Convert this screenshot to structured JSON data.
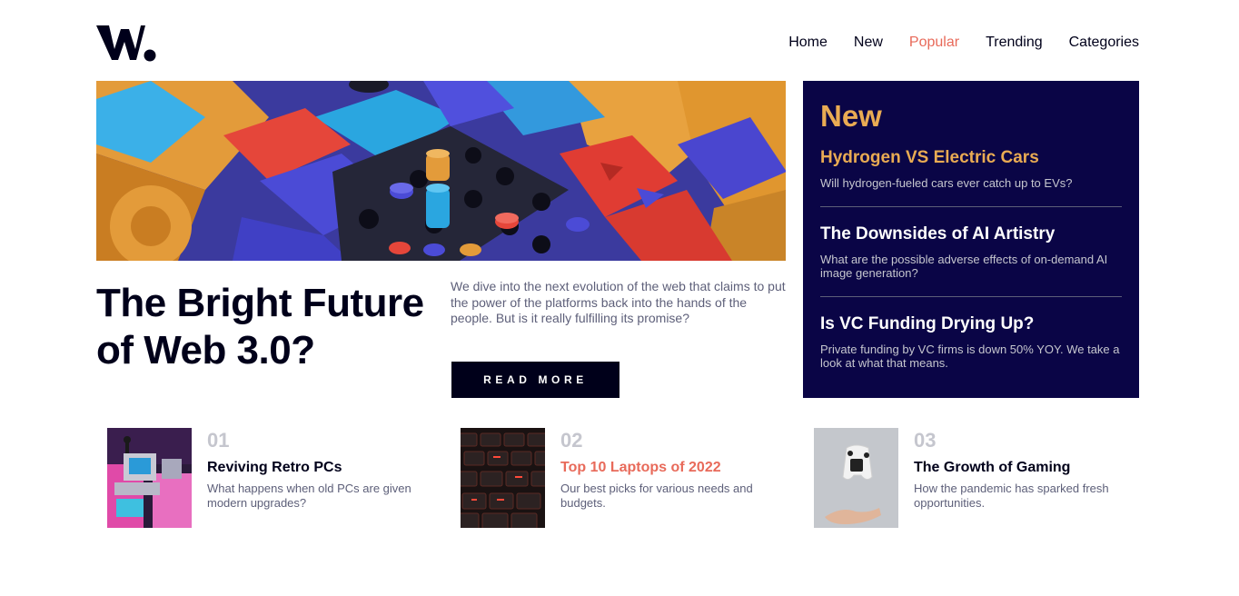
{
  "logo": {
    "text": "W."
  },
  "nav": {
    "items": [
      {
        "label": "Home"
      },
      {
        "label": "New"
      },
      {
        "label": "Popular"
      },
      {
        "label": "Trending"
      },
      {
        "label": "Categories"
      }
    ],
    "active_index": 2
  },
  "hero": {
    "title": "The Bright Future of Web 3.0?",
    "description": "We dive into the next evolution of the web that claims to put the power of the platforms back into the hands of the people. But is it really fulfilling its promise?",
    "button_label": "READ MORE"
  },
  "new_panel": {
    "heading": "New",
    "items": [
      {
        "title": "Hydrogen VS Electric Cars",
        "desc": "Will hydrogen-fueled cars ever catch up to EVs?"
      },
      {
        "title": "The Downsides of AI Artistry",
        "desc": "What are the possible adverse effects of on-demand AI image generation?"
      },
      {
        "title": "Is VC Funding Drying Up?",
        "desc": "Private funding by VC firms is down 50% YOY. We take a look at what that means."
      }
    ]
  },
  "articles": [
    {
      "num": "01",
      "title": "Reviving Retro PCs",
      "desc": "What happens when old PCs are given modern upgrades?"
    },
    {
      "num": "02",
      "title": "Top 10 Laptops of 2022",
      "desc": "Our best picks for various needs and budgets."
    },
    {
      "num": "03",
      "title": "The Growth of Gaming",
      "desc": "How the pandemic has sparked fresh opportunities."
    }
  ],
  "colors": {
    "dark_navy": "#00001a",
    "panel_navy": "#0a0546",
    "soft_orange": "#e9ab53",
    "soft_red": "#e86a5a",
    "grayish_blue": "#5d5f79",
    "light_gray": "#c5c6ce"
  }
}
